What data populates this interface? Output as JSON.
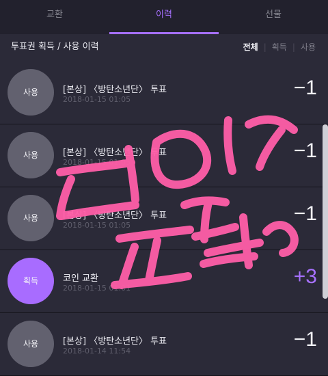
{
  "tabs": [
    {
      "label": "교환",
      "active": false
    },
    {
      "label": "이력",
      "active": true
    },
    {
      "label": "선물",
      "active": false
    }
  ],
  "filterbar": {
    "title": "투표권 획득 / 사용 이력",
    "filters": [
      "전체",
      "획득",
      "사용"
    ],
    "active_filter": "전체"
  },
  "rows": [
    {
      "badge": "사용",
      "title": "[본상] 〈방탄소년단〉 투표",
      "time": "2018-01-15 01:05",
      "amount": "−1",
      "type": "use"
    },
    {
      "badge": "사용",
      "title": "[본상] 〈방탄소년단〉 투표",
      "time": "2018-01-15 01:05",
      "amount": "−1",
      "type": "use"
    },
    {
      "badge": "사용",
      "title": "[본상] 〈방탄소년단〉 투표",
      "time": "2018-01-15 01:05",
      "amount": "−1",
      "type": "use"
    },
    {
      "badge": "획득",
      "title": "코인 교환",
      "time": "2018-01-15 01:01",
      "amount": "+3",
      "type": "earn"
    },
    {
      "badge": "사용",
      "title": "[본상] 〈방탄소년단〉 투표",
      "time": "2018-01-14 11:54",
      "amount": "−1",
      "type": "use"
    }
  ],
  "colors": {
    "accent": "#a771ff",
    "earn_badge": "#a86cff",
    "use_badge": "#62616f",
    "overlay_pink": "#ff5ea8"
  }
}
